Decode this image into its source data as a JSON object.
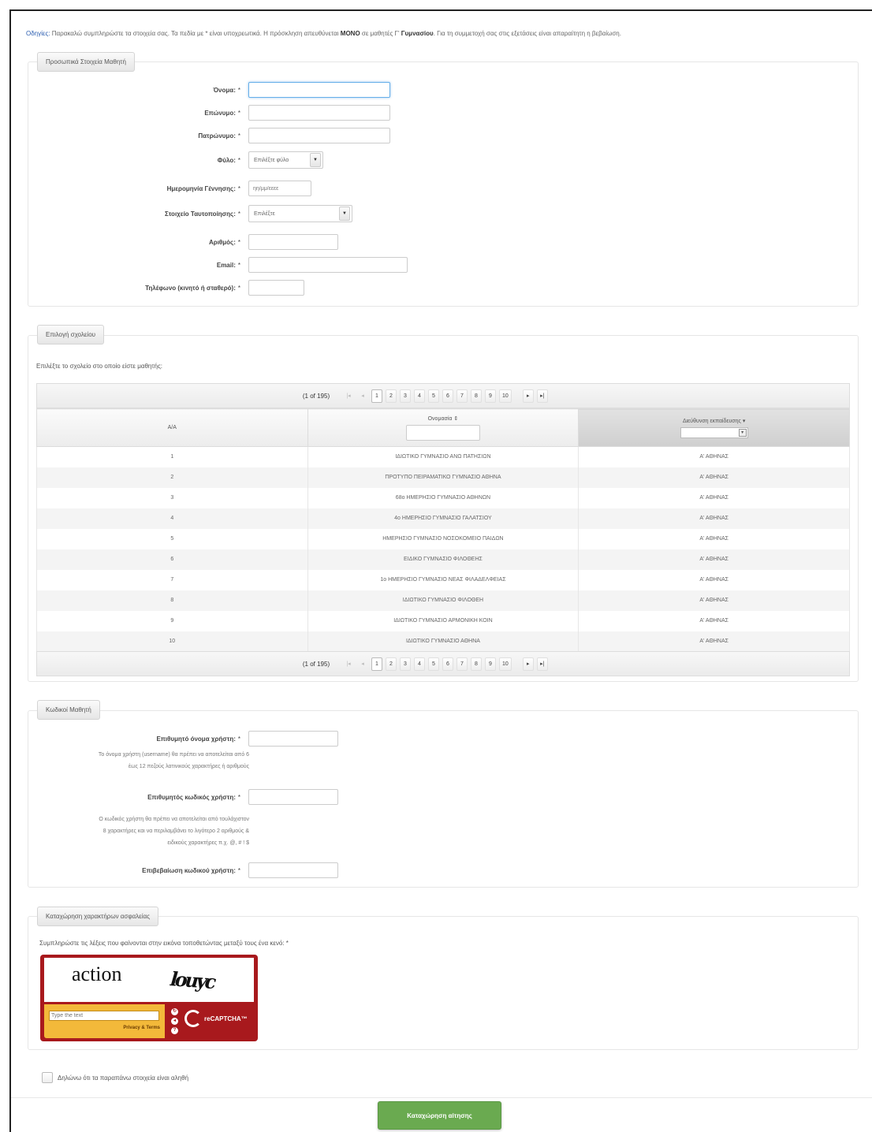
{
  "instructions": {
    "lead": "Οδηγίες:",
    "text_a": " Παρακαλώ συμπληρώστε τα στοιχεία σας. Τα πεδία με * είναι υποχρεωτικά. Η πρόσκληση απευθύνεται ",
    "bold_a": "ΜΟΝΟ",
    "text_b": " σε μαθητές Γ' ",
    "bold_b": "Γυμνασίου",
    "text_c": ". Για τη συμμετοχή σας στις εξετάσεις είναι απαραίτητη η βεβαίωση."
  },
  "personal": {
    "legend": "Προσωπικά Στοιχεία Μαθητή",
    "required_mark": "*",
    "first_name_label": "Όνομα:",
    "last_name_label": "Επώνυμο:",
    "father_name_label": "Πατρώνυμο:",
    "gender_label": "Φύλο:",
    "gender_value": "Επιλέξτε φύλο",
    "dob_label": "Ημερομηνία Γέννησης:",
    "dob_placeholder": "ηη/μμ/εεεε",
    "id_type_label": "Στοιχείο Ταυτοποίησης:",
    "id_type_value": "Επιλέξτε",
    "number_label": "Αριθμός:",
    "email_label": "Email:",
    "phone_label": "Τηλέφωνο (κινητό ή σταθερό):"
  },
  "school": {
    "legend": "Επιλογή σχολείου",
    "prompt": "Επιλέξτε το σχολείο στο οποίο είστε μαθητής:",
    "pager": {
      "current": "(1 of 195)",
      "first": "|◂",
      "prev": "◂",
      "pages": [
        "1",
        "2",
        "3",
        "4",
        "5",
        "6",
        "7",
        "8",
        "9",
        "10"
      ],
      "next": "▸",
      "last": "▸|"
    },
    "columns": [
      "Α/Α",
      "Ονομασία ⇕",
      "Διεύθυνση εκπαίδευσης ▾"
    ],
    "rows": [
      [
        "1",
        "ΙΔΙΩΤΙΚΟ ΓΥΜΝΑΣΙΟ ΑΝΩ ΠΑΤΗΣΙΩΝ",
        "Α' ΑΘΗΝΑΣ"
      ],
      [
        "2",
        "ΠΡΟΤΥΠΟ ΠΕΙΡΑΜΑΤΙΚΟ ΓΥΜΝΑΣΙΟ ΑΘΗΝΑ",
        "Α' ΑΘΗΝΑΣ"
      ],
      [
        "3",
        "68ο ΗΜΕΡΗΣΙΟ ΓΥΜΝΑΣΙΟ ΑΘΗΝΩΝ",
        "Α' ΑΘΗΝΑΣ"
      ],
      [
        "4",
        "4ο ΗΜΕΡΗΣΙΟ ΓΥΜΝΑΣΙΟ ΓΑΛΑΤΣΙΟΥ",
        "Α' ΑΘΗΝΑΣ"
      ],
      [
        "5",
        "ΗΜΕΡΗΣΙΟ ΓΥΜΝΑΣΙΟ ΝΟΣΟΚΟΜΕΙΟ ΠΑΙΔΩΝ",
        "Α' ΑΘΗΝΑΣ"
      ],
      [
        "6",
        "ΕΙΔΙΚΟ ΓΥΜΝΑΣΙΟ ΦΙΛΟΘΕΗΣ",
        "Α' ΑΘΗΝΑΣ"
      ],
      [
        "7",
        "1ο ΗΜΕΡΗΣΙΟ ΓΥΜΝΑΣΙΟ ΝΕΑΣ ΦΙΛΑΔΕΛΦΕΙΑΣ",
        "Α' ΑΘΗΝΑΣ"
      ],
      [
        "8",
        "ΙΔΙΩΤΙΚΟ ΓΥΜΝΑΣΙΟ ΦΙΛΟΘΕΗ",
        "Α' ΑΘΗΝΑΣ"
      ],
      [
        "9",
        "ΙΔΙΩΤΙΚΟ ΓΥΜΝΑΣΙΟ ΑΡΜΟΝΙΚΗ ΚΟΙΝ",
        "Α' ΑΘΗΝΑΣ"
      ],
      [
        "10",
        "ΙΔΙΩΤΙΚΟ ΓΥΜΝΑΣΙΟ ΑΘΗΝΑ",
        "Α' ΑΘΗΝΑΣ"
      ]
    ]
  },
  "credentials": {
    "legend": "Κωδικοί Μαθητή",
    "username_label": "Επιθυμητό όνομα χρήστη:",
    "username_help_1": "Το όνομα χρήστη (username) θα πρέπει να αποτελείται από 6",
    "username_help_2": "έως 12 πεζούς λατινικούς χαρακτήρες ή αριθμούς",
    "password_label": "Επιθυμητός κωδικός χρήστη:",
    "password_help_1": "Ο κωδικός χρήστη θα πρέπει να αποτελείται από τουλάχιστον",
    "password_help_2": "8 χαρακτήρες και να περιλαμβάνει το λιγότερο 2 αριθμούς &",
    "password_help_3": "ειδικούς χαρακτήρες π.χ. @, # ! $",
    "confirm_label": "Επιβεβαίωση κωδικού χρήστη:"
  },
  "captcha": {
    "legend": "Καταχώρηση χαρακτήρων ασφαλείας",
    "prompt": "Συμπληρώστε τις λέξεις που φαίνονται στην εικόνα τοποθετώντας μεταξύ τους ένα κενό: *",
    "word1": "action",
    "word2": "louyc",
    "input_placeholder": "Type the text",
    "privacy": "Privacy & Terms",
    "icon_refresh": "↻",
    "icon_audio": "◂",
    "icon_help": "?",
    "logo_text": "reCAPTCHA™"
  },
  "declaration": "Δηλώνω ότι τα παραπάνω στοιχεία είναι αληθή",
  "submit_label": "Καταχώρηση αίτησης"
}
